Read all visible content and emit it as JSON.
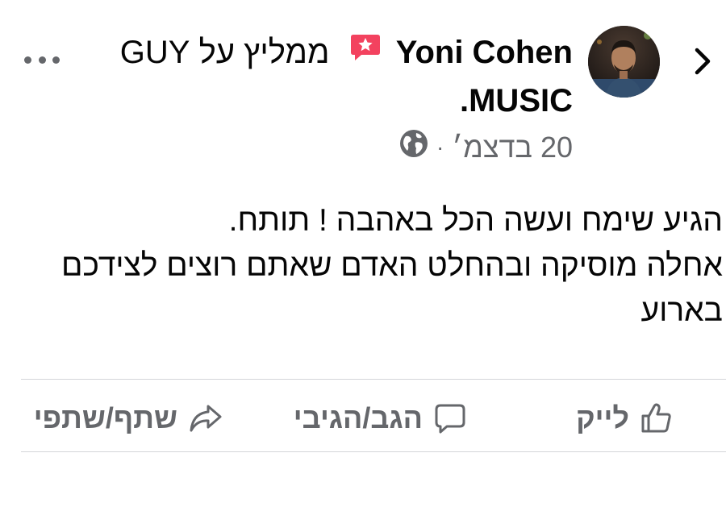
{
  "post": {
    "author": "Yoni Cohen",
    "recommends_text": "ממליץ על GUY",
    "page_name_tail": "MUSIC.",
    "date": "20 בדצמ׳",
    "separator": "·",
    "body_lines": [
      "הגיע שימח ועשה הכל באהבה ! תותח.",
      "אחלה מוסיקה ובהחלט האדם שאתם רוצים לצידכם",
      "בארוע"
    ]
  },
  "actions": {
    "like_label": "לייק",
    "comment_label": "הגב/הגיבי",
    "share_label": "שתף/שתפי"
  },
  "icons": {
    "back": "chevron-right-icon",
    "recommend": "recommend-star-icon",
    "privacy": "globe-icon",
    "more": "more-dots-icon",
    "like": "thumbs-up-icon",
    "comment": "comment-bubble-icon",
    "share": "share-arrow-icon"
  },
  "colors": {
    "text": "#050505",
    "secondary": "#65676b",
    "recommend_badge": "#f3425f",
    "divider": "#d3d5d9"
  }
}
